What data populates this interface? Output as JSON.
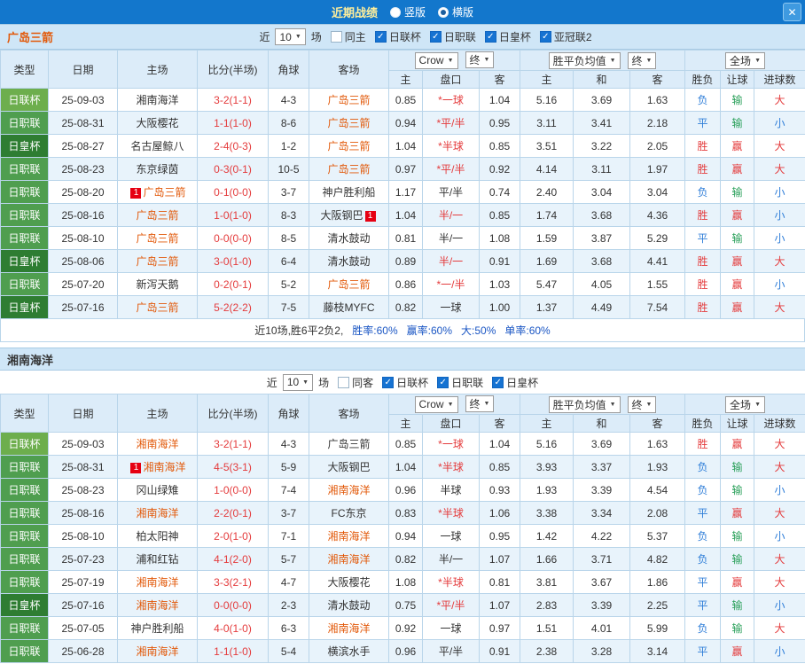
{
  "titlebar": {
    "title": "近期战绩",
    "radios": [
      {
        "label": "竖版",
        "selected": false
      },
      {
        "label": "横版",
        "selected": true
      }
    ]
  },
  "icons": {
    "close": "✕",
    "caret": "▼",
    "check": "✓"
  },
  "colors": {
    "topbar": "#1377cc",
    "title_text": "#ffef9b",
    "team_hot": "#e2590a",
    "score_red": "#e43b3c",
    "handicap_hot": "#e43b3c",
    "summary_stat": "#1a56c4",
    "league": {
      "日联杯": "#6dae4d",
      "日职联": "#4f9e4f",
      "日皇杯": "#2e7d32"
    },
    "result": {
      "胜": "#e43b3c",
      "赢": "#e43b3c",
      "大": "#e43b3c",
      "平": "#2f7ed8",
      "负": "#2f7ed8",
      "小": "#2f7ed8",
      "输": "#2aa05a"
    }
  },
  "sections": [
    {
      "team": "广岛三箭",
      "title_color": "#e2590a",
      "filter": {
        "prefix": "近",
        "count": "10",
        "suffix": "场",
        "checkboxes": [
          {
            "label": "同主",
            "checked": false
          },
          {
            "label": "日联杯",
            "checked": true
          },
          {
            "label": "日职联",
            "checked": true
          },
          {
            "label": "日皇杯",
            "checked": true
          },
          {
            "label": "亚冠联2",
            "checked": true
          }
        ]
      },
      "header": {
        "cols": [
          "类型",
          "日期",
          "主场",
          "比分(半场)",
          "角球",
          "客场"
        ],
        "asian_dropdowns": [
          "Crow",
          "终"
        ],
        "euro_dropdowns": [
          "胜平负均值",
          "终"
        ],
        "result_dropdown": "全场",
        "sub": [
          "主",
          "盘口",
          "客",
          "主",
          "和",
          "客",
          "胜负",
          "让球",
          "进球数"
        ]
      },
      "rows": [
        {
          "league": "日联杯",
          "date": "25-09-03",
          "home": "湘南海洋",
          "home_hot": false,
          "score": "3-2(1-1)",
          "corner": "4-3",
          "away": "广岛三箭",
          "away_hot": true,
          "asian": [
            "0.85",
            "*一球",
            "1.04"
          ],
          "asian_hot": true,
          "euro": [
            "5.16",
            "3.69",
            "1.63"
          ],
          "results": [
            "负",
            "输",
            "大"
          ]
        },
        {
          "league": "日职联",
          "date": "25-08-31",
          "home": "大阪樱花",
          "home_hot": false,
          "score": "1-1(1-0)",
          "corner": "8-6",
          "away": "广岛三箭",
          "away_hot": true,
          "asian": [
            "0.94",
            "*平/半",
            "0.95"
          ],
          "asian_hot": true,
          "euro": [
            "3.11",
            "3.41",
            "2.18"
          ],
          "results": [
            "平",
            "输",
            "小"
          ]
        },
        {
          "league": "日皇杯",
          "date": "25-08-27",
          "home": "名古屋鲸八",
          "home_hot": false,
          "score": "2-4(0-3)",
          "corner": "1-2",
          "away": "广岛三箭",
          "away_hot": true,
          "asian": [
            "1.04",
            "*半球",
            "0.85"
          ],
          "asian_hot": true,
          "euro": [
            "3.51",
            "3.22",
            "2.05"
          ],
          "results": [
            "胜",
            "赢",
            "大"
          ]
        },
        {
          "league": "日职联",
          "date": "25-08-23",
          "home": "东京绿茵",
          "home_hot": false,
          "score": "0-3(0-1)",
          "corner": "10-5",
          "away": "广岛三箭",
          "away_hot": true,
          "asian": [
            "0.97",
            "*平/半",
            "0.92"
          ],
          "asian_hot": true,
          "euro": [
            "4.14",
            "3.11",
            "1.97"
          ],
          "results": [
            "胜",
            "赢",
            "大"
          ]
        },
        {
          "league": "日职联",
          "date": "25-08-20",
          "home": "广岛三箭",
          "home_hot": true,
          "home_card": "1",
          "home_card_pos": "pre",
          "score": "0-1(0-0)",
          "corner": "3-7",
          "away": "神户胜利船",
          "away_hot": false,
          "asian": [
            "1.17",
            "平/半",
            "0.74"
          ],
          "asian_hot": false,
          "euro": [
            "2.40",
            "3.04",
            "3.04"
          ],
          "results": [
            "负",
            "输",
            "小"
          ]
        },
        {
          "league": "日职联",
          "date": "25-08-16",
          "home": "广岛三箭",
          "home_hot": true,
          "score": "1-0(1-0)",
          "corner": "8-3",
          "away": "大阪钢巴",
          "away_hot": false,
          "away_card": "1",
          "away_card_pos": "post",
          "asian": [
            "1.04",
            "半/一",
            "0.85"
          ],
          "asian_hot": true,
          "euro": [
            "1.74",
            "3.68",
            "4.36"
          ],
          "results": [
            "胜",
            "赢",
            "小"
          ]
        },
        {
          "league": "日职联",
          "date": "25-08-10",
          "home": "广岛三箭",
          "home_hot": true,
          "score": "0-0(0-0)",
          "corner": "8-5",
          "away": "清水鼓动",
          "away_hot": false,
          "asian": [
            "0.81",
            "半/一",
            "1.08"
          ],
          "asian_hot": false,
          "euro": [
            "1.59",
            "3.87",
            "5.29"
          ],
          "results": [
            "平",
            "输",
            "小"
          ]
        },
        {
          "league": "日皇杯",
          "date": "25-08-06",
          "home": "广岛三箭",
          "home_hot": true,
          "score": "3-0(1-0)",
          "corner": "6-4",
          "away": "清水鼓动",
          "away_hot": false,
          "asian": [
            "0.89",
            "半/一",
            "0.91"
          ],
          "asian_hot": true,
          "euro": [
            "1.69",
            "3.68",
            "4.41"
          ],
          "results": [
            "胜",
            "赢",
            "大"
          ]
        },
        {
          "league": "日职联",
          "date": "25-07-20",
          "home": "新泻天鹅",
          "home_hot": false,
          "score": "0-2(0-1)",
          "corner": "5-2",
          "away": "广岛三箭",
          "away_hot": true,
          "asian": [
            "0.86",
            "*一/半",
            "1.03"
          ],
          "asian_hot": true,
          "euro": [
            "5.47",
            "4.05",
            "1.55"
          ],
          "results": [
            "胜",
            "赢",
            "小"
          ]
        },
        {
          "league": "日皇杯",
          "date": "25-07-16",
          "home": "广岛三箭",
          "home_hot": true,
          "score": "5-2(2-2)",
          "corner": "7-5",
          "away": "藤枝MYFC",
          "away_hot": false,
          "asian": [
            "0.82",
            "一球",
            "1.00"
          ],
          "asian_hot": false,
          "euro": [
            "1.37",
            "4.49",
            "7.54"
          ],
          "results": [
            "胜",
            "赢",
            "大"
          ]
        }
      ],
      "summary": {
        "prefix": "近10场,胜6平2负2,",
        "stats": [
          "胜率:60%",
          "赢率:60%",
          "大:50%",
          "单率:60%"
        ]
      }
    },
    {
      "team": "湘南海洋",
      "title_color": "#333333",
      "filter": {
        "prefix": "近",
        "count": "10",
        "suffix": "场",
        "checkboxes": [
          {
            "label": "同客",
            "checked": false
          },
          {
            "label": "日联杯",
            "checked": true
          },
          {
            "label": "日职联",
            "checked": true
          },
          {
            "label": "日皇杯",
            "checked": true
          }
        ]
      },
      "header": {
        "cols": [
          "类型",
          "日期",
          "主场",
          "比分(半场)",
          "角球",
          "客场"
        ],
        "asian_dropdowns": [
          "Crow",
          "终"
        ],
        "euro_dropdowns": [
          "胜平负均值",
          "终"
        ],
        "result_dropdown": "全场",
        "sub": [
          "主",
          "盘口",
          "客",
          "主",
          "和",
          "客",
          "胜负",
          "让球",
          "进球数"
        ]
      },
      "rows": [
        {
          "league": "日联杯",
          "date": "25-09-03",
          "home": "湘南海洋",
          "home_hot": true,
          "score": "3-2(1-1)",
          "corner": "4-3",
          "away": "广岛三箭",
          "away_hot": false,
          "asian": [
            "0.85",
            "*一球",
            "1.04"
          ],
          "asian_hot": true,
          "euro": [
            "5.16",
            "3.69",
            "1.63"
          ],
          "results": [
            "胜",
            "赢",
            "大"
          ]
        },
        {
          "league": "日职联",
          "date": "25-08-31",
          "home": "湘南海洋",
          "home_hot": true,
          "home_card": "1",
          "home_card_pos": "pre",
          "score": "4-5(3-1)",
          "corner": "5-9",
          "away": "大阪钢巴",
          "away_hot": false,
          "asian": [
            "1.04",
            "*半球",
            "0.85"
          ],
          "asian_hot": true,
          "euro": [
            "3.93",
            "3.37",
            "1.93"
          ],
          "results": [
            "负",
            "输",
            "大"
          ]
        },
        {
          "league": "日职联",
          "date": "25-08-23",
          "home": "冈山绿雉",
          "home_hot": false,
          "score": "1-0(0-0)",
          "corner": "7-4",
          "away": "湘南海洋",
          "away_hot": true,
          "asian": [
            "0.96",
            "半球",
            "0.93"
          ],
          "asian_hot": false,
          "euro": [
            "1.93",
            "3.39",
            "4.54"
          ],
          "results": [
            "负",
            "输",
            "小"
          ]
        },
        {
          "league": "日职联",
          "date": "25-08-16",
          "home": "湘南海洋",
          "home_hot": true,
          "score": "2-2(0-1)",
          "corner": "3-7",
          "away": "FC东京",
          "away_hot": false,
          "asian": [
            "0.83",
            "*半球",
            "1.06"
          ],
          "asian_hot": true,
          "euro": [
            "3.38",
            "3.34",
            "2.08"
          ],
          "results": [
            "平",
            "赢",
            "大"
          ]
        },
        {
          "league": "日职联",
          "date": "25-08-10",
          "home": "柏太阳神",
          "home_hot": false,
          "score": "2-0(1-0)",
          "corner": "7-1",
          "away": "湘南海洋",
          "away_hot": true,
          "asian": [
            "0.94",
            "一球",
            "0.95"
          ],
          "asian_hot": false,
          "euro": [
            "1.42",
            "4.22",
            "5.37"
          ],
          "results": [
            "负",
            "输",
            "小"
          ]
        },
        {
          "league": "日职联",
          "date": "25-07-23",
          "home": "浦和红钻",
          "home_hot": false,
          "score": "4-1(2-0)",
          "corner": "5-7",
          "away": "湘南海洋",
          "away_hot": true,
          "asian": [
            "0.82",
            "半/一",
            "1.07"
          ],
          "asian_hot": false,
          "euro": [
            "1.66",
            "3.71",
            "4.82"
          ],
          "results": [
            "负",
            "输",
            "大"
          ]
        },
        {
          "league": "日职联",
          "date": "25-07-19",
          "home": "湘南海洋",
          "home_hot": true,
          "score": "3-3(2-1)",
          "corner": "4-7",
          "away": "大阪樱花",
          "away_hot": false,
          "asian": [
            "1.08",
            "*半球",
            "0.81"
          ],
          "asian_hot": true,
          "euro": [
            "3.81",
            "3.67",
            "1.86"
          ],
          "results": [
            "平",
            "赢",
            "大"
          ]
        },
        {
          "league": "日皇杯",
          "date": "25-07-16",
          "home": "湘南海洋",
          "home_hot": true,
          "score": "0-0(0-0)",
          "corner": "2-3",
          "away": "清水鼓动",
          "away_hot": false,
          "asian": [
            "0.75",
            "*平/半",
            "1.07"
          ],
          "asian_hot": true,
          "euro": [
            "2.83",
            "3.39",
            "2.25"
          ],
          "results": [
            "平",
            "输",
            "小"
          ]
        },
        {
          "league": "日职联",
          "date": "25-07-05",
          "home": "神户胜利船",
          "home_hot": false,
          "score": "4-0(1-0)",
          "corner": "6-3",
          "away": "湘南海洋",
          "away_hot": true,
          "asian": [
            "0.92",
            "一球",
            "0.97"
          ],
          "asian_hot": false,
          "euro": [
            "1.51",
            "4.01",
            "5.99"
          ],
          "results": [
            "负",
            "输",
            "大"
          ]
        },
        {
          "league": "日职联",
          "date": "25-06-28",
          "home": "湘南海洋",
          "home_hot": true,
          "score": "1-1(1-0)",
          "corner": "5-4",
          "away": "横滨水手",
          "away_hot": false,
          "asian": [
            "0.96",
            "平/半",
            "0.91"
          ],
          "asian_hot": false,
          "euro": [
            "2.38",
            "3.28",
            "3.14"
          ],
          "results": [
            "平",
            "赢",
            "小"
          ]
        }
      ],
      "summary": null
    }
  ]
}
